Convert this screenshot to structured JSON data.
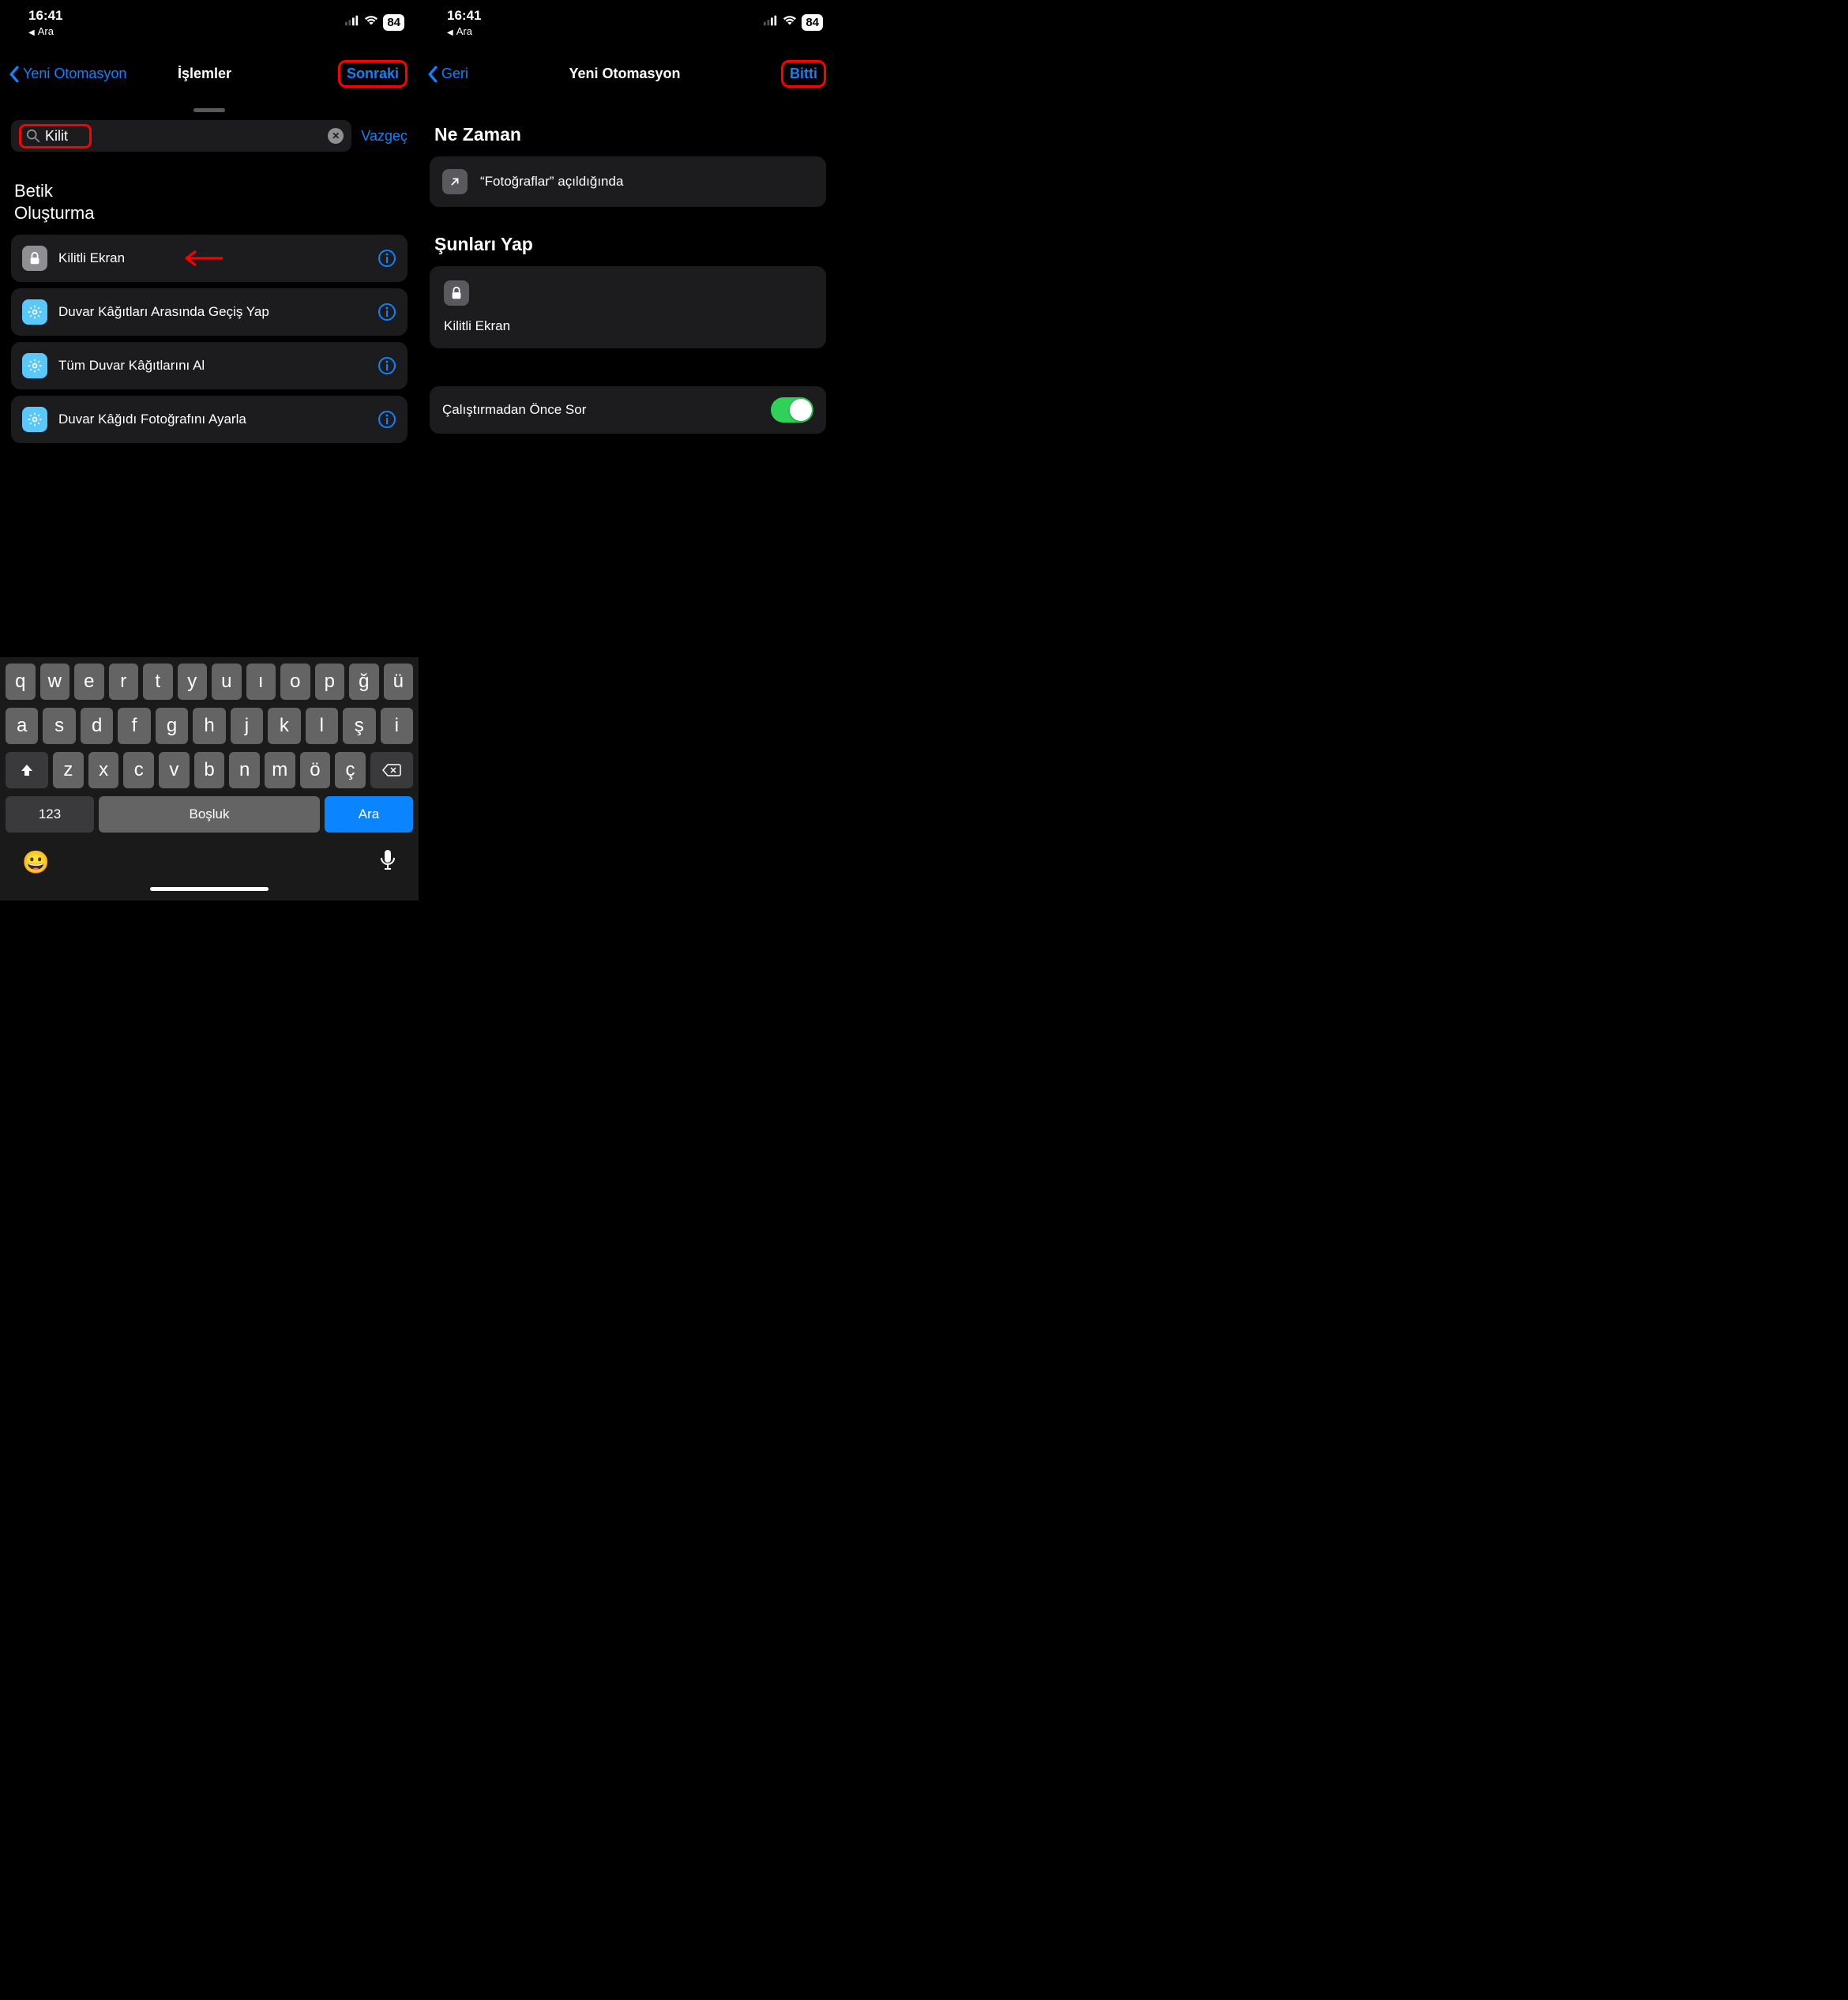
{
  "status": {
    "time": "16:41",
    "back": "Ara",
    "battery": "84"
  },
  "left": {
    "nav": {
      "back": "Yeni Otomasyon",
      "title": "İşlemler",
      "next": "Sonraki"
    },
    "search": {
      "value": "Kilit",
      "cancel": "Vazgeç"
    },
    "section": "Betik\nOluşturma",
    "actions": [
      {
        "label": "Kilitli Ekran",
        "icon": "lock",
        "style": "grey"
      },
      {
        "label": "Duvar Kâğıtları Arasında Geçiş Yap",
        "icon": "gear",
        "style": "blue"
      },
      {
        "label": "Tüm Duvar Kâğıtlarını Al",
        "icon": "gear",
        "style": "blue"
      },
      {
        "label": "Duvar Kâğıdı Fotoğrafını Ayarla",
        "icon": "gear",
        "style": "blue"
      }
    ],
    "keyboard": {
      "row1": [
        "q",
        "w",
        "e",
        "r",
        "t",
        "y",
        "u",
        "ı",
        "o",
        "p",
        "ğ",
        "ü"
      ],
      "row2": [
        "a",
        "s",
        "d",
        "f",
        "g",
        "h",
        "j",
        "k",
        "l",
        "ş",
        "i"
      ],
      "row3": [
        "z",
        "x",
        "c",
        "v",
        "b",
        "n",
        "m",
        "ö",
        "ç"
      ],
      "num": "123",
      "space": "Boşluk",
      "search": "Ara"
    }
  },
  "right": {
    "nav": {
      "back": "Geri",
      "title": "Yeni Otomasyon",
      "done": "Bitti"
    },
    "when": {
      "title": "Ne Zaman",
      "text": "“Fotoğraflar” açıldığında"
    },
    "do": {
      "title": "Şunları Yap",
      "action": "Kilitli Ekran"
    },
    "toggle": {
      "label": "Çalıştırmadan Önce Sor"
    }
  }
}
